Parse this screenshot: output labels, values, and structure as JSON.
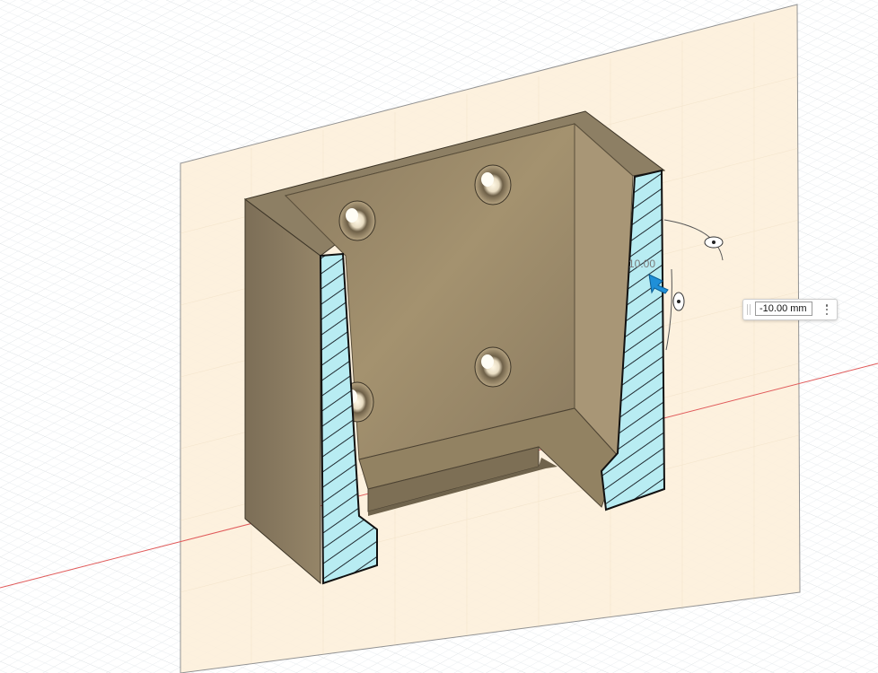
{
  "viewport": {
    "background": "#ffffff",
    "grid_color": "#d8dde0",
    "sketch_plane_color": "#fdf0dc",
    "body_color": "#9b8b6d",
    "section_fill_color": "#b8ecf2",
    "x_axis_color": "#e05a5a"
  },
  "manipulator": {
    "ghost_value": "10.00",
    "arrow_icon": "drag-arrow-icon",
    "rotate_handles": [
      "rotate-handle-icon",
      "rotate-handle-icon"
    ]
  },
  "dimension_input": {
    "value": "-10.00 mm",
    "menu_icon": "more-options-icon"
  }
}
